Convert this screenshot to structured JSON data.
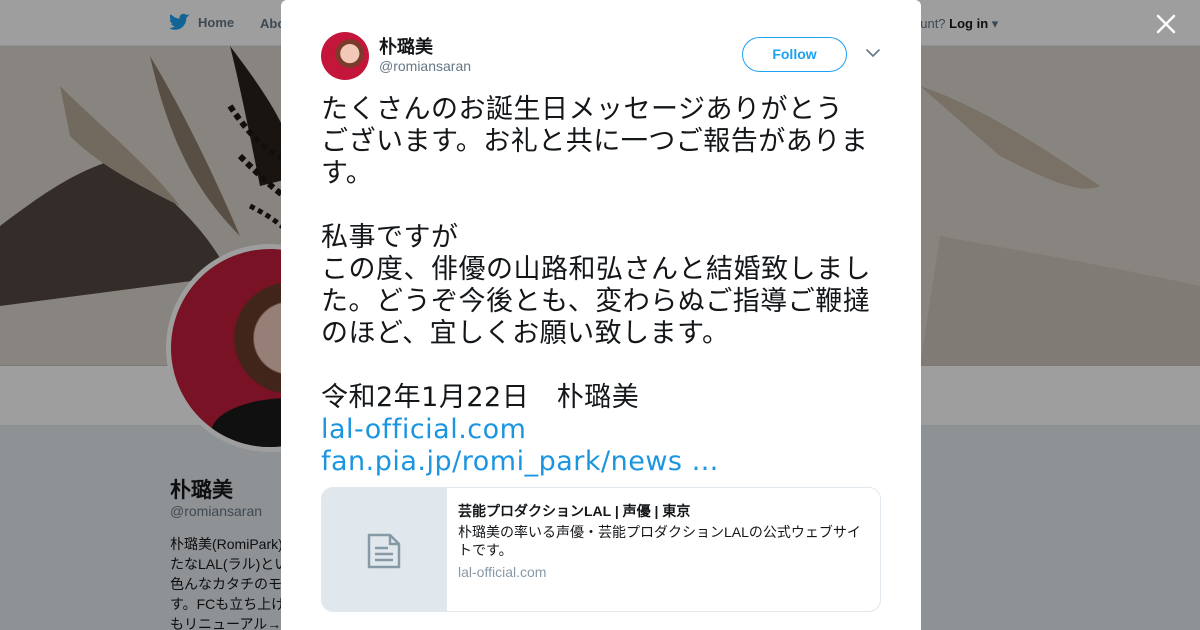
{
  "topbar": {
    "home_label": "Home",
    "about_label": "Abo",
    "account_prompt": "ccount?",
    "login_label": "Log in"
  },
  "profile_bg": {
    "name": "朴璐美",
    "handle": "@romiansaran",
    "bio_lines": [
      "朴璐美(RomiPark)",
      "たなLAL(ラル)とい",
      "色んなカタチのモ",
      "す。FCも立ち上げ",
      "もリニューアル→"
    ]
  },
  "tweet": {
    "author_name": "朴璐美",
    "author_handle": "@romiansaran",
    "follow_label": "Follow",
    "text_lines": [
      "たくさんのお誕生日メッセージありがとう",
      "ございます。お礼と共に一つご報告がありま",
      "す。",
      "",
      "私事ですが",
      "この度、俳優の山路和弘さんと結婚致しまし",
      "た。どうぞ今後とも、変わらぬご指導ご鞭撻",
      "のほど、宜しくお願い致します。",
      "",
      "令和2年1月22日　朴璐美"
    ],
    "links": [
      "lal-official.com",
      "fan.pia.jp/romi_park/news …"
    ],
    "card": {
      "title": "芸能プロダクションLAL | 声優 | 東京",
      "description": "朴璐美の率いる声優・芸能プロダクションLALの公式ウェブサイトです。",
      "domain": "lal-official.com"
    }
  },
  "colors": {
    "brand_blue": "#1da1f2",
    "link_blue": "#1b95e0",
    "text_primary": "#14171a",
    "text_secondary": "#657786"
  },
  "icons": {
    "close": "close-icon",
    "chevron": "chevron-down-icon",
    "twitter": "twitter-bird-icon",
    "card_doc": "document-icon"
  }
}
